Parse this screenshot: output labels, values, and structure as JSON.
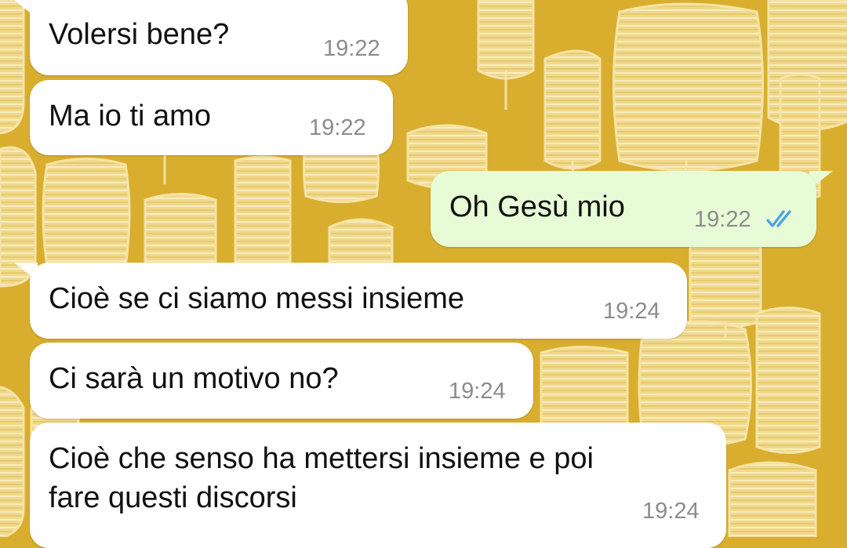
{
  "colors": {
    "wallpaper": "#d9ae2e",
    "incoming_bubble": "#ffffff",
    "outgoing_bubble": "#e7fcd6",
    "timestamp": "#8c8c8c",
    "read_ticks": "#4fa3e0"
  },
  "messages": [
    {
      "direction": "incoming",
      "text": "Volersi bene?",
      "time": "19:22"
    },
    {
      "direction": "incoming",
      "text": "Ma io ti amo",
      "time": "19:22"
    },
    {
      "direction": "outgoing",
      "text": "Oh Gesù mio",
      "time": "19:22",
      "status_icon": "double-check-read-icon"
    },
    {
      "direction": "incoming",
      "text": "Cioè se ci siamo messi insieme",
      "time": "19:24"
    },
    {
      "direction": "incoming",
      "text": "Ci sarà un motivo no?",
      "time": "19:24"
    },
    {
      "direction": "incoming",
      "text": "Cioè che senso ha mettersi insieme e poi\nfare questi discorsi",
      "time": "19:24"
    }
  ]
}
